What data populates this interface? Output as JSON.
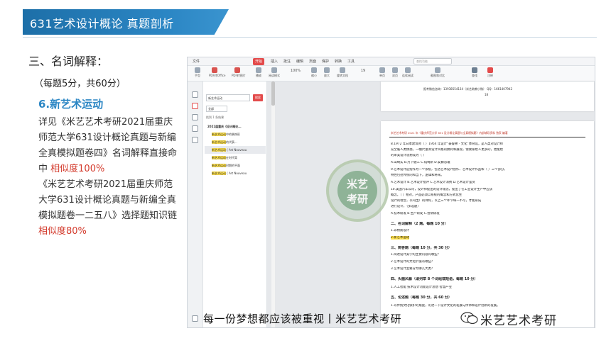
{
  "banner": {
    "title": "631艺术设计概论  真题剖析"
  },
  "left": {
    "section_title": "三、名词解释：",
    "scoring": "（每题5分，共60分）",
    "term": "6.新艺术运动",
    "para1_a": "详见《米艺艺术考研2021届重庆师范大学631设计概论真题与新编全真模拟题卷四》名词解释直接命中",
    "para1_b": "相似度100%",
    "para2_a": "《米艺艺术考研2021届重庆师范大学631设计概论真题与新编全真模拟题卷一二五八》选择题知识链",
    "para2_b": "相似度80%"
  },
  "app": {
    "tabs": [
      "文件",
      "开始",
      "插入",
      "批注",
      "编辑",
      "页面",
      "保护",
      "转换",
      "工具"
    ],
    "active_tab": "开始",
    "search_placeholder": "查找功能",
    "toolbar": [
      "手型",
      "选择",
      "PDF转Office",
      "PDF转图片",
      "播放",
      "阅读模式",
      "100%",
      "缩小",
      "放大",
      "旋转文档",
      "单页",
      "双页",
      "连续阅读",
      "截图和对比",
      "查找",
      "注释"
    ],
    "page_indicator": "19",
    "panel": {
      "search_value": "新艺术运动",
      "search_btn": "搜索",
      "scope": "全部",
      "status": "找到 1 条结果",
      "result_head": "2021届重庆《设计概论...",
      "results": [
        {
          "pre": "",
          "hl": "新艺术运动",
          "post": "中的装饰形",
          "page": ""
        },
        {
          "pre": "",
          "hl": "新艺术运动",
          "post": "的代表...",
          "page": ""
        },
        {
          "pre": "",
          "hl": "新艺术运动",
          "post": " ( Art Nouveau",
          "page": ""
        },
        {
          "pre": "",
          "hl": "新艺术运动",
          "post": "在时代背",
          "page": ""
        },
        {
          "pre": "",
          "hl": "新艺术运动",
          "post": "时期的平面",
          "page": ""
        },
        {
          "pre": "",
          "hl": "新艺术运动",
          "post": " ( Art Nouveau",
          "page": ""
        }
      ]
    },
    "page1": {
      "contact": "报考微信咨询：13938554134（米艺助教小微） QQ：1661407942",
      "num": "18"
    },
    "page2": {
      "header": "米艺艺术考研 2021 年《重庆师范大学 631 设计概论真题与全真模拟题》内部辅导资料 独家 编著",
      "lines": [
        "8.1972 年日本建筑师（        ）1954 年设计“豪鲁弗 · 文化”体育馆，是人类对设计师",
        "充全展人类情感，一幢尺量高设计风格的摸刺和展现，需要家给人更多的，更能给",
        "的审美设计思想成为（    ）",
        "A.山崎实        B.丹下健三      C.矶崎新       D.安藤忠雄",
        "9.艺术设计是指作为一个系统，包括艺术设计创作、艺术设计作品和（        ）三个部分，",
        "特性包括传统的和当下，逻辑和将来。",
        "A.艺术设计                B.艺术设计批评      C.艺术设计消费      D.艺术设计鉴赏",
        "10.美国汽车公司，设计师提出的设计理念，提出了在工业设计生产中应该",
        "概念，（              ）相对，产品必须以系统的概念和方式化生",
        "设计的理念，公司出厂的目标，以上三个环节缺一不可，才能形成",
        "进行设计，（多选题）",
        "A.技术研发            B.生产研发          C.营销研发",
        "二、名词解释（2 题，每题 10 分）",
        "1.非物质设计",
        "2.新艺术运动",
        "三、简答题（每题 10 分，共 30 分）",
        "1.简述设计美学的主要内容有哪些？",
        "2.艺术设计的文化价值有哪些？",
        "3.艺术设计主要分为哪几大类？",
        "四、头脑风暴（请列举 8 个词组或短语，每题 10 分）",
        "1.人工智能  技术设计功能设计思想  智慧产业",
        "五、论述题（每题 30 分，共 60 分）",
        "1.以传统文化保护的角度，论述一下设计文化的发展与传承和设计创新的发展。"
      ]
    },
    "stamp": {
      "line1": "米艺",
      "line2": "考研"
    }
  },
  "caption": "每一份梦想都应该被重视丨米艺艺术考研",
  "watermark": "米艺艺术考研",
  "colors": {
    "accent": "#2b86c4",
    "highlight_red": "#d33a2c",
    "app_red": "#e34b4b",
    "highlight_yellow": "#ffe14d"
  }
}
